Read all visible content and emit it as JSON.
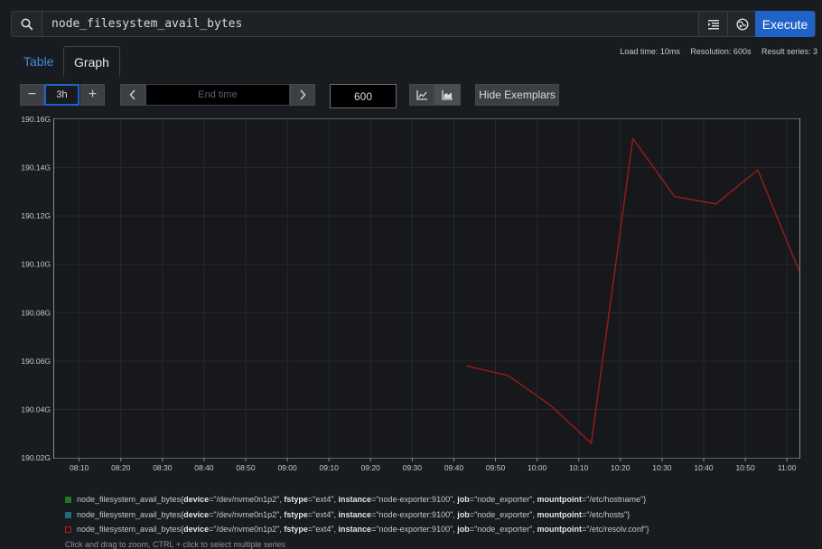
{
  "query": {
    "value": "node_filesystem_avail_bytes"
  },
  "execute_label": "Execute",
  "stats": {
    "load_time": "Load time: 10ms",
    "resolution": "Resolution: 600s",
    "result_series": "Result series: 3"
  },
  "tabs": {
    "table": "Table",
    "graph": "Graph"
  },
  "controls": {
    "minus": "−",
    "range": "3h",
    "plus": "+",
    "end_time_placeholder": "End time",
    "resolution_value": "600",
    "hide_exemplars": "Hide Exemplars"
  },
  "colors": {
    "accent": "#1f62c8",
    "link": "#3d8bdc",
    "series_line": "#8b1c1c"
  },
  "chart_data": {
    "type": "line",
    "y_ticks": [
      "190.16G",
      "190.14G",
      "190.12G",
      "190.10G",
      "190.08G",
      "190.06G",
      "190.04G",
      "190.02G"
    ],
    "y_tick_values": [
      190.16,
      190.14,
      190.12,
      190.1,
      190.08,
      190.06,
      190.04,
      190.02
    ],
    "ylim": [
      190.02,
      190.16
    ],
    "x_ticks": [
      "08:10",
      "08:20",
      "08:30",
      "08:40",
      "08:50",
      "09:00",
      "09:10",
      "09:20",
      "09:30",
      "09:40",
      "09:50",
      "10:00",
      "10:10",
      "10:20",
      "10:30",
      "10:40",
      "10:50",
      "11:00"
    ],
    "xlim": [
      "08:04",
      "11:03"
    ],
    "grid": true,
    "series": [
      {
        "metric": "node_filesystem_avail_bytes",
        "labels": [
          {
            "key": "device",
            "value": "\"/dev/nvme0n1p2\""
          },
          {
            "key": "fstype",
            "value": "\"ext4\""
          },
          {
            "key": "instance",
            "value": "\"node-exporter:9100\""
          },
          {
            "key": "job",
            "value": "\"node_exporter\""
          },
          {
            "key": "mountpoint",
            "value": "\"/etc/hostname\""
          }
        ],
        "color": "#1e7a1e",
        "x": [],
        "y": []
      },
      {
        "metric": "node_filesystem_avail_bytes",
        "labels": [
          {
            "key": "device",
            "value": "\"/dev/nvme0n1p2\""
          },
          {
            "key": "fstype",
            "value": "\"ext4\""
          },
          {
            "key": "instance",
            "value": "\"node-exporter:9100\""
          },
          {
            "key": "job",
            "value": "\"node_exporter\""
          },
          {
            "key": "mountpoint",
            "value": "\"/etc/hosts\""
          }
        ],
        "color": "#1f6b76",
        "x": [],
        "y": []
      },
      {
        "metric": "node_filesystem_avail_bytes",
        "labels": [
          {
            "key": "device",
            "value": "\"/dev/nvme0n1p2\""
          },
          {
            "key": "fstype",
            "value": "\"ext4\""
          },
          {
            "key": "instance",
            "value": "\"node-exporter:9100\""
          },
          {
            "key": "job",
            "value": "\"node_exporter\""
          },
          {
            "key": "mountpoint",
            "value": "\"/etc/resolv.conf\""
          }
        ],
        "color": "#8b1c1c",
        "x": [
          "09:43",
          "09:53",
          "10:03",
          "10:13",
          "10:23",
          "10:33",
          "10:43",
          "10:53",
          "11:03"
        ],
        "y": [
          190.058,
          190.054,
          190.042,
          190.026,
          190.152,
          190.128,
          190.125,
          190.139,
          190.097
        ]
      }
    ]
  },
  "hint": "Click and drag to zoom, CTRL + click to select multiple series"
}
